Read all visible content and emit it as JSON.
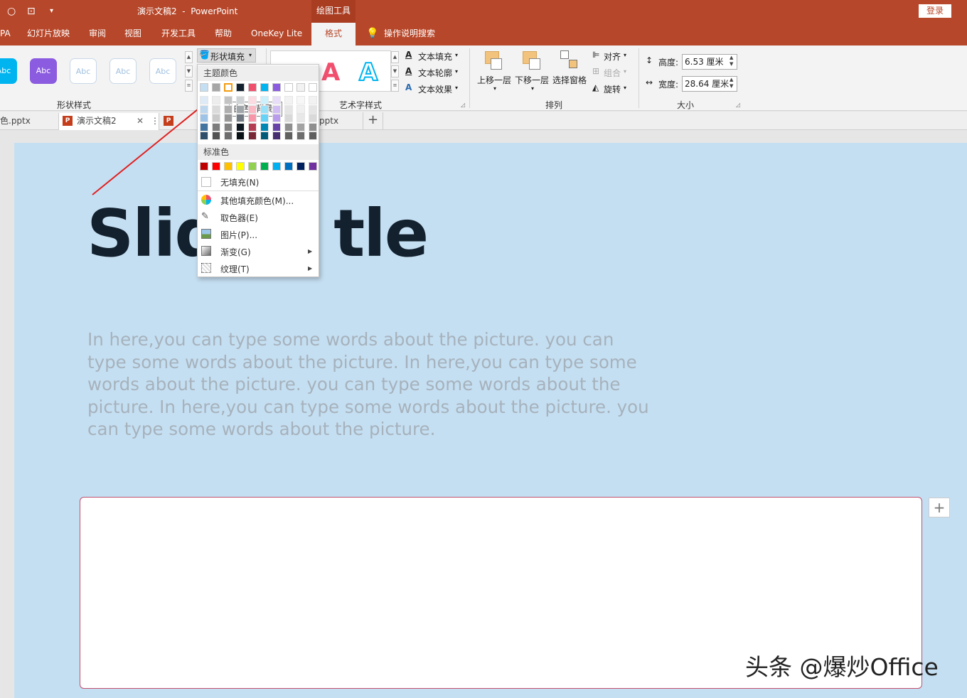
{
  "app": {
    "title": "演示文稿2  -  PowerPoint",
    "context_tab": "绘图工具",
    "login": "登录"
  },
  "tabs": [
    "PA",
    "幻灯片放映",
    "审阅",
    "视图",
    "开发工具",
    "帮助",
    "OneKey Lite",
    "格式"
  ],
  "active_tab": "格式",
  "tell_me": "操作说明搜索",
  "ribbon": {
    "shape_styles": {
      "label": "形状样式",
      "preset_text": "Abc"
    },
    "shape_fill": "形状填充",
    "wordart": {
      "label": "艺术字样式",
      "text_fill": "文本填充",
      "text_outline": "文本轮廓",
      "text_effects": "文本效果",
      "letter": "A"
    },
    "arrange": {
      "label": "排列",
      "bring_forward": "上移一层",
      "send_backward": "下移一层",
      "selection_pane": "选择窗格",
      "align": "对齐",
      "group": "组合",
      "rotate": "旋转"
    },
    "size": {
      "label": "大小",
      "height_label": "高度:",
      "height_value": "6.53 厘米",
      "width_label": "宽度:",
      "width_value": "28.64 厘米"
    }
  },
  "doc_tabs": [
    "色.pptx",
    "演示文稿2",
    "pptx"
  ],
  "slide": {
    "title": "Slide Title",
    "title_visible_left": "Slid",
    "title_visible_right": "tle",
    "body": "In here,you can type some words about the picture. you can type some words about the picture. In here,you can type some words about the picture. you can type some words about the picture. In here,you can type some words about the picture. you can type some words about the picture."
  },
  "dropdown": {
    "theme_header": "主题颜色",
    "standard_header": "标准色",
    "no_fill": "无填充(N)",
    "more_colors": "其他填充颜色(M)...",
    "eyedropper": "取色器(E)",
    "picture": "图片(P)...",
    "gradient": "渐变(G)",
    "texture": "纹理(T)",
    "tooltip": "白色, 背景 2",
    "theme_colors": [
      "#c5dff2",
      "#a6a6a6",
      "#ffffff",
      "#13212e",
      "#f0506e",
      "#00b4f0",
      "#8b5be0",
      "#ffffff",
      "#f2f2f2",
      "#ffffff"
    ],
    "standard_colors": [
      "#c00000",
      "#ff0000",
      "#ffc000",
      "#ffff00",
      "#92d050",
      "#00b050",
      "#00b0f0",
      "#0070c0",
      "#002060",
      "#7030a0"
    ]
  },
  "watermark": "头条 @爆炒Office"
}
